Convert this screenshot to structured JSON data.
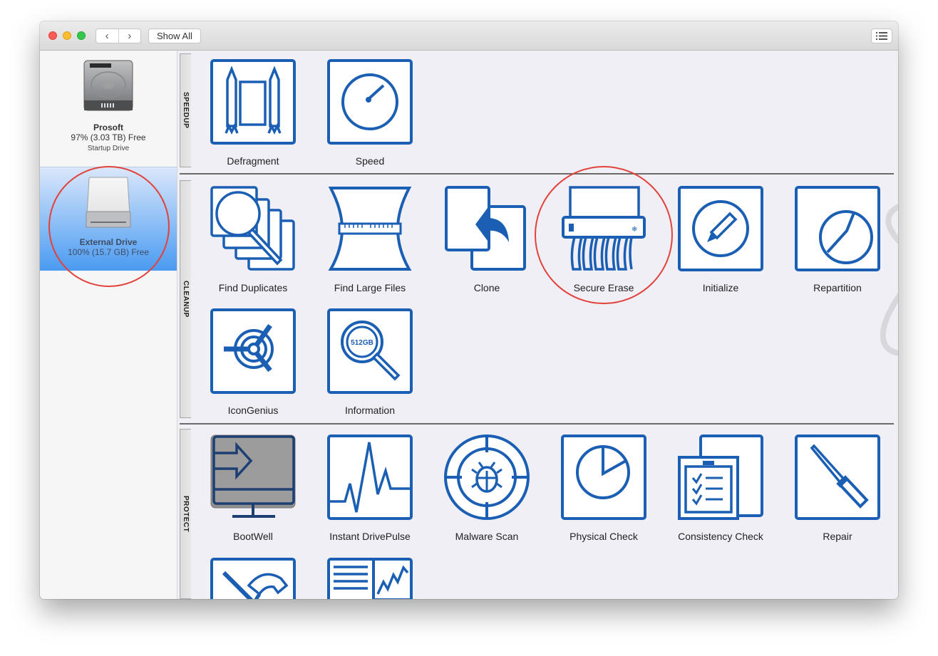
{
  "window": {
    "show_all_label": "Show All",
    "nav": {
      "back": "‹",
      "forward": "›"
    },
    "list_view_icon": "list-icon"
  },
  "sidebar": {
    "drives": [
      {
        "name": "Prosoft",
        "free": "97% (3.03 TB) Free",
        "subtitle": "Startup Drive",
        "icon": "hard-drive-icon",
        "selected": false
      },
      {
        "name": "External Drive",
        "free": "100% (15.7 GB) Free",
        "subtitle": "",
        "icon": "external-drive-icon",
        "selected": true
      }
    ]
  },
  "sections": [
    {
      "title": "SPEEDUP",
      "tools": [
        {
          "label": "Defragment",
          "icon": "rockets-icon"
        },
        {
          "label": "Speed",
          "icon": "gauge-icon"
        }
      ]
    },
    {
      "title": "CLEANUP",
      "tools": [
        {
          "label": "Find Duplicates",
          "icon": "duplicates-magnifier-icon"
        },
        {
          "label": "Find Large Files",
          "icon": "measuring-tape-icon"
        },
        {
          "label": "Clone",
          "icon": "clone-arrow-icon"
        },
        {
          "label": "Secure Erase",
          "icon": "shredder-icon"
        },
        {
          "label": "Initialize",
          "icon": "pencil-circle-icon"
        },
        {
          "label": "Repartition",
          "icon": "partition-circle-icon"
        },
        {
          "label": "IconGenius",
          "icon": "target-icon"
        },
        {
          "label": "Information",
          "icon": "info-magnifier-icon",
          "badge": "512GB"
        }
      ]
    },
    {
      "title": "PROTECT",
      "tools": [
        {
          "label": "BootWell",
          "icon": "monitor-arrow-icon"
        },
        {
          "label": "Instant DrivePulse",
          "icon": "pulse-icon"
        },
        {
          "label": "Malware Scan",
          "icon": "bug-target-icon"
        },
        {
          "label": "Physical Check",
          "icon": "pie-icon"
        },
        {
          "label": "Consistency Check",
          "icon": "checklist-icon"
        },
        {
          "label": "Repair",
          "icon": "screwdriver-icon"
        },
        {
          "label": "",
          "icon": "hammer-screwdriver-icon"
        },
        {
          "label": "",
          "icon": "report-chart-icon"
        }
      ]
    }
  ],
  "colors": {
    "icon_blue": "#1a5fb4",
    "highlight_red": "#e2423b",
    "selection_blue": "#4a9bf1"
  }
}
